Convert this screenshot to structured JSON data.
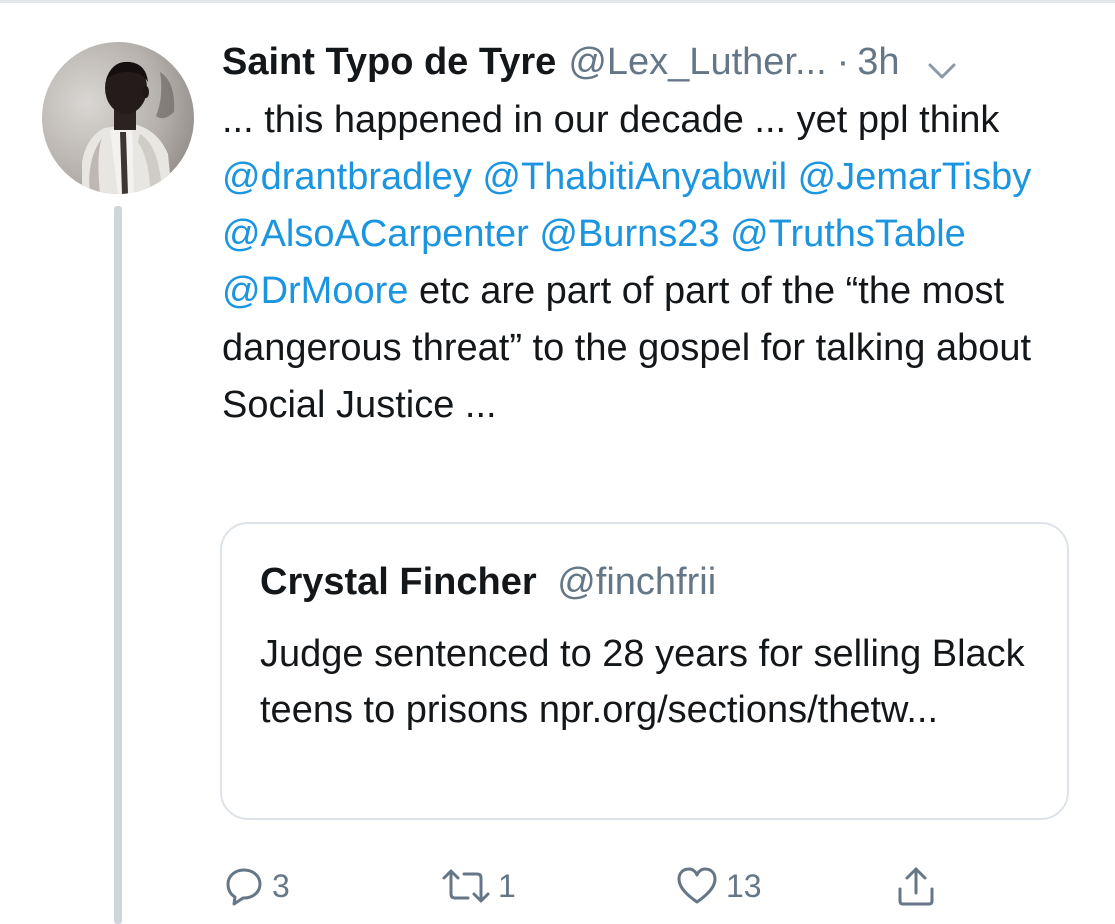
{
  "tweet": {
    "author_name": "Saint Typo de Tyre",
    "author_handle": "@Lex_Luther...",
    "separator": "·",
    "time": "3h",
    "text_parts": {
      "intro": "... this happened in our decade ... yet ppl think ",
      "mentions": [
        "@drantbradley",
        "@ThabitiAnyabwil",
        "@JemarTisby",
        "@AlsoACarpenter",
        "@Burns23",
        "@TruthsTable",
        "@DrMoore"
      ],
      "outro": " etc are part of part of the “the most dangerous threat” to the gospel for talking about Social Justice ..."
    },
    "icons": {
      "caret": "chevron-down-icon",
      "avatar": "avatar-portrait"
    }
  },
  "quoted_tweet": {
    "author_name": "Crystal Fincher",
    "author_handle": "@finchfrii",
    "text": "Judge sentenced to 28 years for selling Black teens to prisons npr.org/sections/thetw..."
  },
  "actions": {
    "reply_count": "3",
    "retweet_count": "1",
    "like_count": "13",
    "icons": [
      "reply-icon",
      "retweet-icon",
      "like-icon",
      "share-icon"
    ]
  },
  "colors": {
    "mention": "#1b95e0",
    "secondary_text": "#657786",
    "border": "#dde3e8",
    "thread_line": "#cfd5da"
  }
}
